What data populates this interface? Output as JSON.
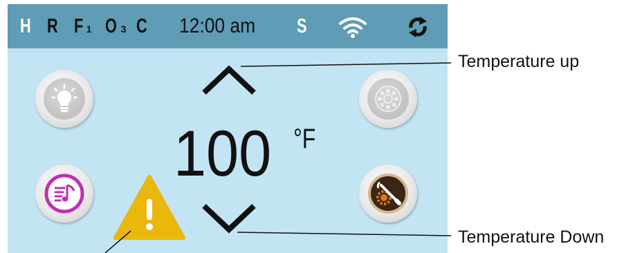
{
  "status_bar": {
    "heater": "H",
    "ready": "R",
    "filter": "F",
    "filter_sub": "1",
    "ozone": "O",
    "ozone_sub": "3",
    "cleanup": "C",
    "time": "12:00 am",
    "sensor": "S",
    "wifi_icon": "wifi-icon",
    "refresh_icon": "refresh-icon",
    "bg_color": "#5f9cb5"
  },
  "main": {
    "temperature": "100",
    "unit": "°F",
    "bg_color": "#c3e4f3",
    "buttons": [
      "light",
      "jets",
      "music",
      "settings"
    ],
    "warning_icon": "warning-icon"
  },
  "callouts": {
    "temp_up": "Temperature up",
    "temp_down": "Temperature Down"
  }
}
